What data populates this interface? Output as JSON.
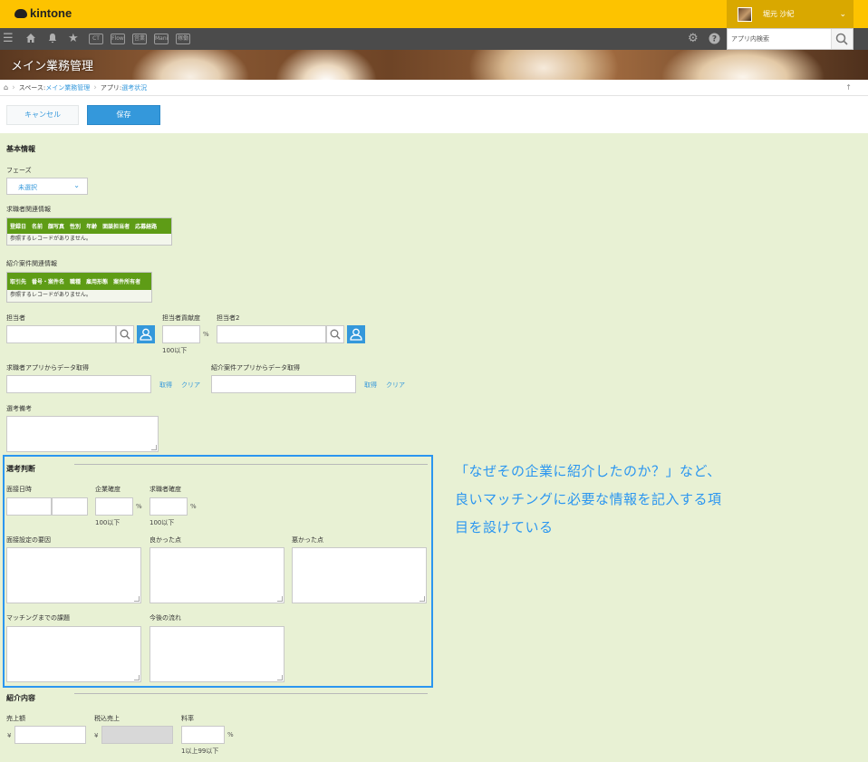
{
  "header": {
    "logo": "kintone",
    "user_name": "堀元 沙紀"
  },
  "nav": {
    "apps": [
      "CT",
      "Flow",
      "営業",
      "Mani",
      "稼働"
    ],
    "search_placeholder": "アプリ内検索"
  },
  "banner": {
    "title": "メイン業務管理"
  },
  "breadcrumb": {
    "space_label": "スペース: ",
    "space_link": "メイン業務管理",
    "app_label": "アプリ: ",
    "app_link": "選考状況"
  },
  "actions": {
    "cancel": "キャンセル",
    "save": "保存"
  },
  "form": {
    "basic_info": "基本情報",
    "phase_label": "フェーズ",
    "phase_value": "未選択",
    "candidate_ref_label": "求職者関連情報",
    "candidate_ref_columns": [
      "登録日",
      "名前",
      "顔写真",
      "性別",
      "年齢",
      "面談担当者",
      "応募経路"
    ],
    "candidate_ref_empty": "参照するレコードがありません。",
    "job_ref_label": "紹介案件関連情報",
    "job_ref_columns": [
      "取引先",
      "番号・案件名",
      "職種",
      "雇用形態",
      "案件所有者"
    ],
    "job_ref_empty": "参照するレコードがありません。",
    "assignee_label": "担当者",
    "assignee_contrib_label": "担当者貢献度",
    "assignee_contrib_unit": "%",
    "assignee_contrib_hint": "100以下",
    "assignee2_label": "担当者2",
    "candidate_fetch_label": "求職者アプリからデータ取得",
    "job_fetch_label": "紹介案件アプリからデータ取得",
    "fetch_link": "取得",
    "clear_link": "クリア",
    "selection_note_label": "選考備考",
    "judgement_title": "選考判断",
    "interview_datetime_label": "面接日時",
    "company_certainty_label": "企業確度",
    "candidate_certainty_label": "求職者確度",
    "percent_unit": "%",
    "max100_hint": "100以下",
    "interview_reason_label": "面接設定の要因",
    "good_points_label": "良かった点",
    "bad_points_label": "悪かった点",
    "matching_issues_label": "マッチングまでの課題",
    "next_flow_label": "今後の流れ",
    "intro_title": "紹介内容",
    "sales_label": "売上額",
    "sales_tax_label": "税込売上",
    "yen": "¥",
    "fee_rate_label": "料率",
    "fee_rate_hint": "1以上99以下"
  },
  "annotation": {
    "line1": "「なぜその企業に紹介したのか？」など、",
    "line2": "良いマッチングに必要な情報を記入する項",
    "line3": "目を設けている"
  },
  "colors": {
    "header_yellow": "#fdc300",
    "form_background": "#e8f1d4",
    "accent_blue": "#3498db",
    "reference_green": "#5e9c16",
    "highlight_blue": "#2b96f0"
  }
}
